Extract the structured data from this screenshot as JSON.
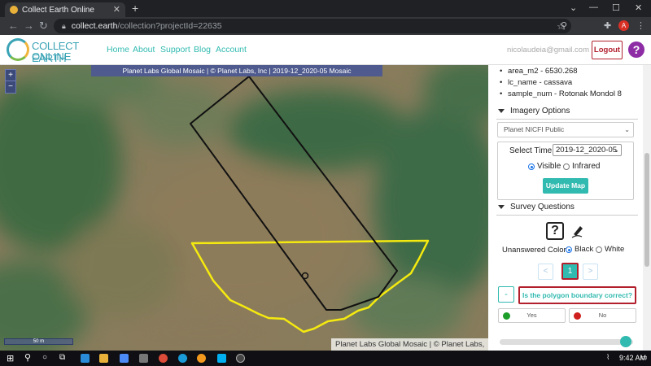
{
  "browser": {
    "tab_title": "Collect Earth Online",
    "url_host": "collect.earth",
    "url_path": "/collection?projectId=22635",
    "avatar_letter": "A"
  },
  "site": {
    "logo_line1": "COLLECT EARTH",
    "logo_line2": "ONLINE",
    "nav": [
      "Home",
      "About",
      "Support",
      "Blog",
      "Account"
    ],
    "user_email": "nicolaudeia@gmail.com",
    "logout_label": "Logout",
    "help_label": "?"
  },
  "map": {
    "attribution_top": "Planet Labs Global Mosaic | © Planet Labs, Inc | 2019-12_2020-05 Mosaic",
    "attribution_bottom": "Planet Labs Global Mosaic | © Planet Labs, Inc",
    "zoom_in": "+",
    "zoom_out": "−",
    "scale_label": "50 m",
    "colors": {
      "plot_boundary": "#111111",
      "sample_polygon": "#f5ea0f"
    }
  },
  "sidebar": {
    "plot_info": [
      "area_m2 - 6530.268",
      "lc_name - cassava",
      "sample_num - Rotonak Mondol 8"
    ],
    "imagery": {
      "header": "Imagery Options",
      "source": "Planet NICFI Public",
      "select_time_label": "Select Time",
      "select_time_value": "2019-12_2020-05",
      "band_options": [
        "Visible",
        "Infrared"
      ],
      "band_selected": "Visible",
      "update_button": "Update Map"
    },
    "survey": {
      "header": "Survey Questions",
      "unanswered_color_label": "Unanswered Color",
      "color_options": [
        "Black",
        "White"
      ],
      "color_selected": "Black",
      "prev": "<",
      "page": "1",
      "next": ">",
      "collapse_label": "-",
      "question": "Is the polygon boundary correct?",
      "answers": [
        {
          "label": "Yes",
          "color": "#1e9e2a"
        },
        {
          "label": "No",
          "color": "#d01f1f"
        }
      ]
    }
  },
  "taskbar": {
    "time": "9:42 AM"
  }
}
